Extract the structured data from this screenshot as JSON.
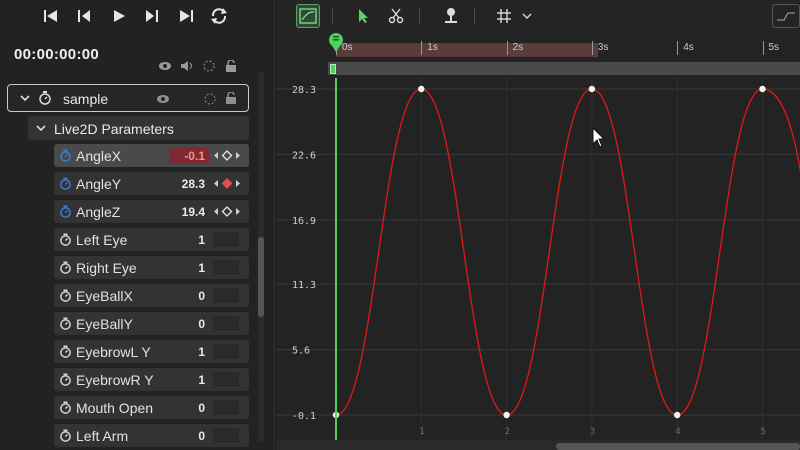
{
  "transport": {
    "timecode": "00:00:00:00",
    "buttons": [
      "skip-to-start-icon",
      "previous-frame-icon",
      "play-icon",
      "next-frame-icon",
      "skip-to-end-icon",
      "loop-icon"
    ]
  },
  "tree": {
    "object_label": "sample",
    "group_label": "Live2D Parameters",
    "parameters": [
      {
        "name": "AngleX",
        "value": "-0.1",
        "keyed": true,
        "selected": true,
        "negative": true,
        "key_color": "#e8e8e8"
      },
      {
        "name": "AngleY",
        "value": "28.3",
        "keyed": true,
        "selected": false,
        "negative": false,
        "key_color": "#e84b4b"
      },
      {
        "name": "AngleZ",
        "value": "19.4",
        "keyed": true,
        "selected": false,
        "negative": false,
        "key_color": "#e8e8e8"
      },
      {
        "name": "Left Eye",
        "value": "1",
        "keyed": false
      },
      {
        "name": "Right Eye",
        "value": "1",
        "keyed": false
      },
      {
        "name": "EyeBallX",
        "value": "0",
        "keyed": false
      },
      {
        "name": "EyeBallY",
        "value": "0",
        "keyed": false
      },
      {
        "name": "EyebrowL Y",
        "value": "1",
        "keyed": false
      },
      {
        "name": "EyebrowR Y",
        "value": "1",
        "keyed": false
      },
      {
        "name": "Mouth Open",
        "value": "0",
        "keyed": false
      },
      {
        "name": "Left Arm",
        "value": "0",
        "keyed": false
      }
    ]
  },
  "ruler": {
    "labels": [
      "0s",
      "1s",
      "2s",
      "3s",
      "4s",
      "5s"
    ]
  },
  "chart_data": {
    "type": "line",
    "x_labels": [
      "1",
      "2",
      "3",
      "4",
      "5"
    ],
    "y_ticks": [
      "28.3",
      "22.6",
      "16.9",
      "11.3",
      "5.6",
      "-0.1"
    ],
    "ylim": [
      -0.1,
      28.3
    ],
    "xlim": [
      0,
      5.35
    ],
    "keyframes": [
      {
        "x": 0,
        "y": -0.1
      },
      {
        "x": 1,
        "y": 28.3
      },
      {
        "x": 2,
        "y": -0.1
      },
      {
        "x": 3,
        "y": 28.3
      },
      {
        "x": 4,
        "y": -0.1
      },
      {
        "x": 5,
        "y": 28.3
      }
    ],
    "curve_color": "#e01818",
    "playhead_color": "#4fd160",
    "grid": true
  },
  "colors": {
    "accent_green": "#4fd160",
    "curve_red": "#e01818",
    "param_icon_blue": "#3a7bd5"
  }
}
